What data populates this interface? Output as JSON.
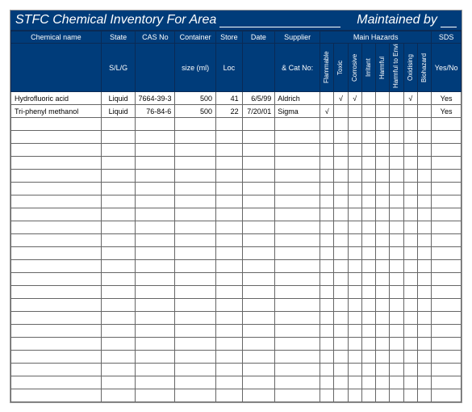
{
  "title": {
    "prefix": "STFC Chemical Inventory For Area",
    "area": "",
    "maintained_label": "Maintained by",
    "maintained_by": ""
  },
  "headers": {
    "row1": {
      "name": "Chemical name",
      "state": "State",
      "cas": "CAS No",
      "container": "Container",
      "store": "Store",
      "date": "Date",
      "supplier": "Supplier",
      "hazards": "Main Hazards",
      "sds": "SDS"
    },
    "row2": {
      "name": "",
      "state": "S/L/G",
      "cas": "",
      "container": "size (ml)",
      "store": "Loc",
      "date": "",
      "supplier": "& Cat No:",
      "sds": "Yes/No"
    },
    "hazard_cols": [
      "Flammable",
      "Toxic",
      "Corrosive",
      "Irritant",
      "Harmful",
      "Harmful to Environ.",
      "Oxidising",
      "Biohazard"
    ]
  },
  "rows": [
    {
      "name": "Hydrofluoric acid",
      "state": "Liquid",
      "cas": "7664-39-3",
      "container": "500",
      "store": "41",
      "date": "6/5/99",
      "supplier": "Aldrich",
      "hz": [
        "",
        "√",
        "√",
        "",
        "",
        "",
        "√",
        ""
      ],
      "sds": "Yes"
    },
    {
      "name": "Tri-phenyl methanol",
      "state": "Liquid",
      "cas": "76-84-6",
      "container": "500",
      "store": "22",
      "date": "7/20/01",
      "supplier": "Sigma",
      "hz": [
        "√",
        "",
        "",
        "",
        "",
        "",
        "",
        ""
      ],
      "sds": "Yes"
    }
  ],
  "empty_rows": 22
}
